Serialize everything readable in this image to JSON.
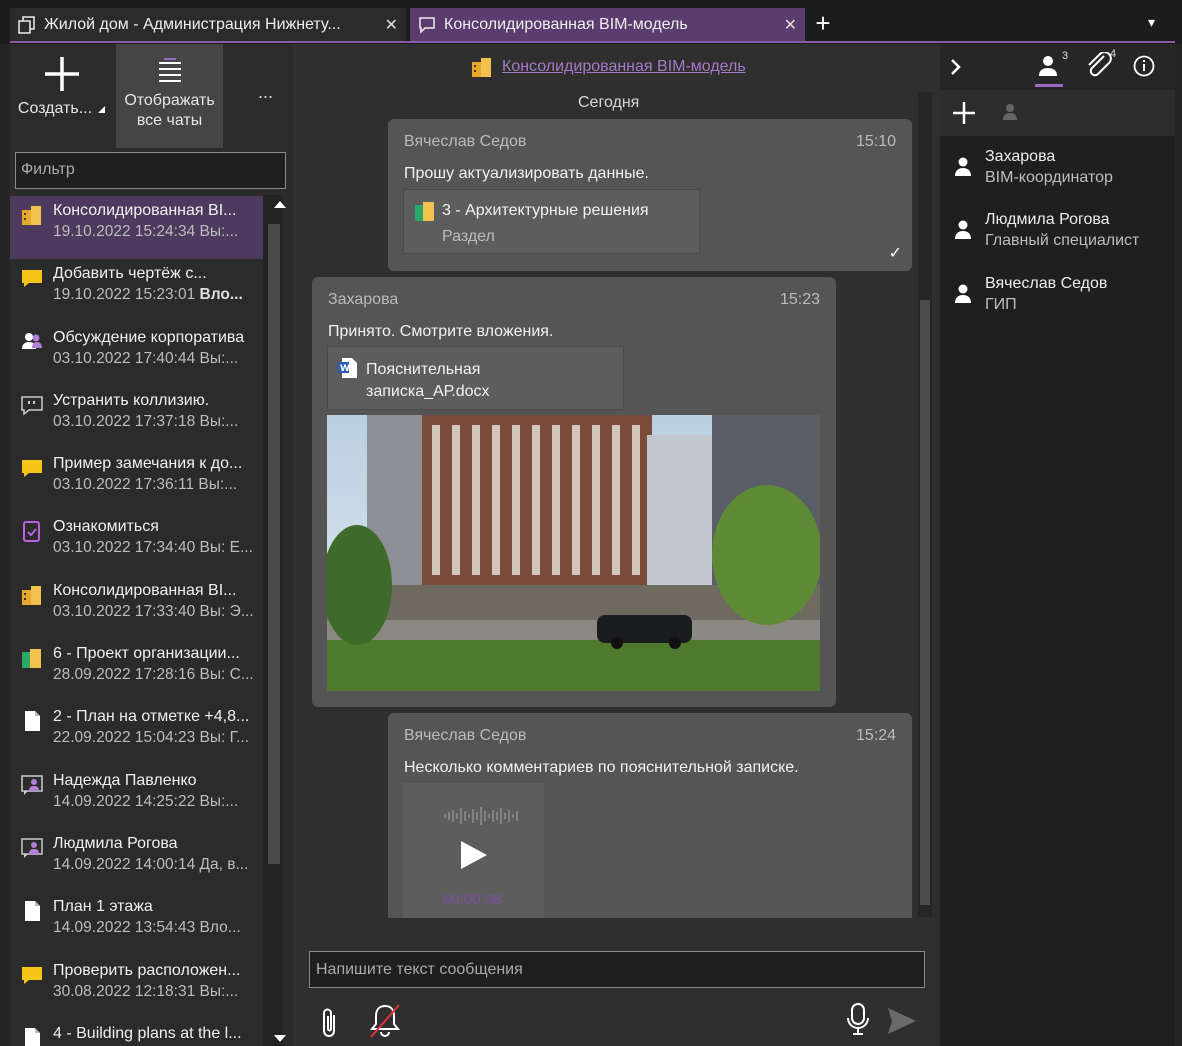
{
  "tabs": [
    {
      "label": "Жилой дом - Администрация Нижнету...",
      "close": "✕"
    },
    {
      "label": "Консолидированная BIM-модель",
      "close": "✕"
    }
  ],
  "tab_add": "+",
  "tab_menu": "▾",
  "toolbar": {
    "create_label": "Создать...",
    "show_all_line1": "Отображать",
    "show_all_line2": "все чаты",
    "more": "..."
  },
  "filter": {
    "placeholder": "Фильтр"
  },
  "chats": [
    {
      "title": "Консолидированная BI...",
      "sub": "19.10.2022 15:24:34  Вы:...",
      "icon": "bim-model-icon",
      "active": true
    },
    {
      "title": "Добавить чертёж с...",
      "sub_date": "19.10.2022 15:23:01 ",
      "sub_bold": "Вло...",
      "icon": "note-icon"
    },
    {
      "title": "Обсуждение корпоратива",
      "sub": "03.10.2022 17:40:44  Вы:...",
      "icon": "group-icon"
    },
    {
      "title": "Устранить коллизию.",
      "sub": "03.10.2022 17:37:18  Вы:...",
      "icon": "comment-icon"
    },
    {
      "title": "Пример замечания к до...",
      "sub": "03.10.2022 17:36:11  Вы:...",
      "icon": "note-icon"
    },
    {
      "title": "Ознакомиться",
      "sub": "03.10.2022 17:34:40  Вы: Е...",
      "icon": "task-icon"
    },
    {
      "title": "Консолидированная BI...",
      "sub": "03.10.2022 17:33:40  Вы: Э...",
      "icon": "bim-model-icon"
    },
    {
      "title": "6 - Проект организации...",
      "sub": "28.09.2022 17:28:16  Вы: С...",
      "icon": "section-icon"
    },
    {
      "title": "2 - План на отметке +4,8...",
      "sub": "22.09.2022 15:04:23  Вы: Г...",
      "icon": "document-icon"
    },
    {
      "title": "Надежда Павленко",
      "sub": "14.09.2022 14:25:22  Вы:...",
      "icon": "person-chat-icon"
    },
    {
      "title": "Людмила Рогова",
      "sub": "14.09.2022 14:00:14  Да, в...",
      "icon": "person-chat-icon"
    },
    {
      "title": "План 1 этажа",
      "sub": "14.09.2022 13:54:43  Вло...",
      "icon": "document-icon"
    },
    {
      "title": "Проверить расположен...",
      "sub": "30.08.2022 12:18:31  Вы:...",
      "icon": "note-icon"
    },
    {
      "title": "4 - Building plans at the l...",
      "sub": "",
      "icon": "document-icon"
    }
  ],
  "conversation": {
    "title": "Консолидированная BIM-модель",
    "day": "Сегодня",
    "messages": [
      {
        "author": "Вячеслав Седов",
        "time": "15:10",
        "text": "Прошу актуализировать данные.",
        "attachment_title": "3 - Архитектурные решения",
        "attachment_sub": "Раздел",
        "status": "✓"
      },
      {
        "author": "Захарова",
        "time": "15:23",
        "text": "Принято. Смотрите вложения.",
        "file_line1": "Пояснительная",
        "file_line2": "записка_АР.docx"
      },
      {
        "author": "Вячеслав Седов",
        "time": "15:24",
        "text": "Несколько комментариев по пояснительной записке.",
        "audio_time": "00:00:08"
      }
    ]
  },
  "composer": {
    "placeholder": "Напишите текст сообщения"
  },
  "right_panel": {
    "members_count": "3",
    "attachments_count": "4",
    "members": [
      {
        "name": "Захарова",
        "role": "BIM-координатор"
      },
      {
        "name": "Людмила Рогова",
        "role": "Главный специалист"
      },
      {
        "name": "Вячеслав Седов",
        "role": "ГИП"
      }
    ]
  },
  "colors": {
    "accent": "#8a5aa8",
    "active_tab": "#5a3d6e",
    "link": "#a779c9"
  }
}
